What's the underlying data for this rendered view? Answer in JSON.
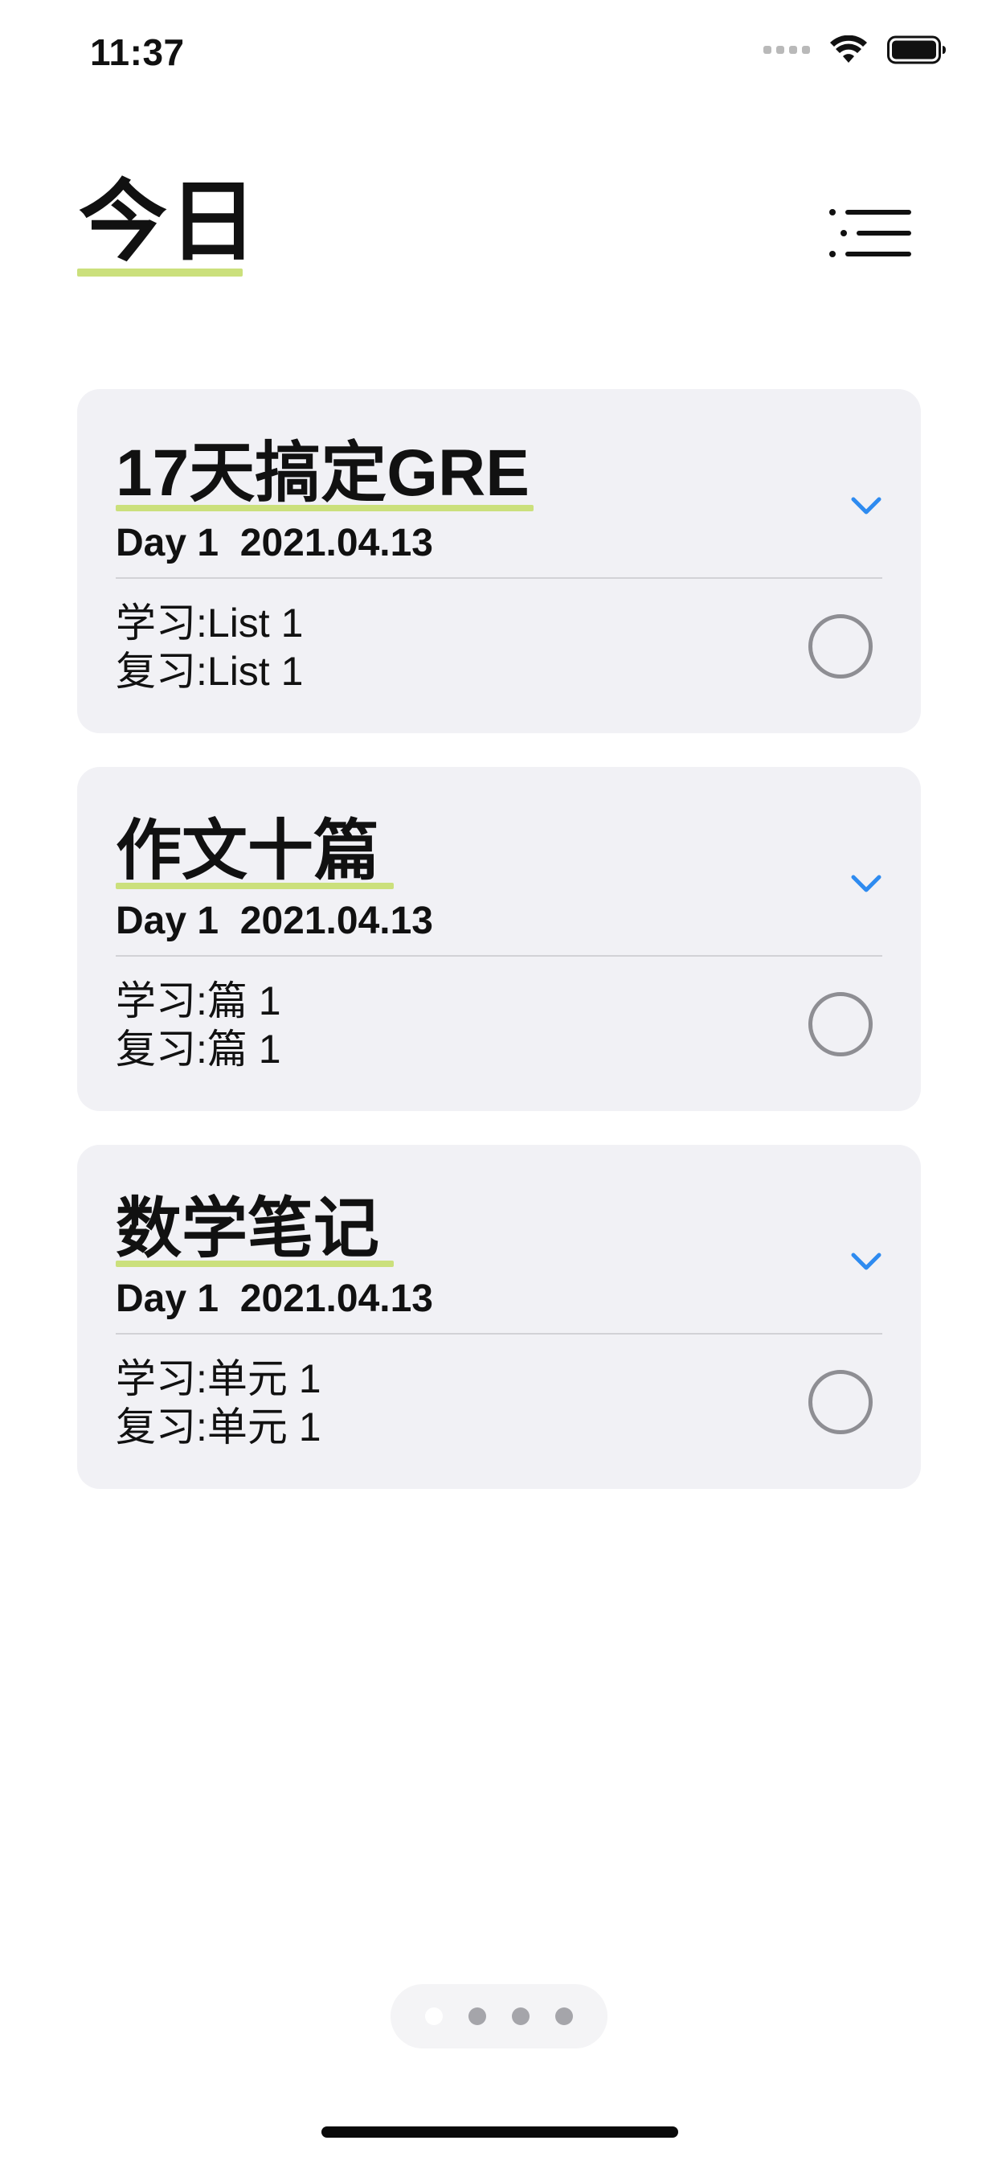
{
  "status_bar": {
    "time": "11:37",
    "icons": [
      "signal-icon",
      "wifi-icon",
      "battery-icon"
    ]
  },
  "header": {
    "title": "今日",
    "menu_icon": "menu-icon"
  },
  "colors": {
    "accent_underline": "#cbe07c",
    "chevron_blue": "#2e8bf0",
    "card_background": "#f1f1f5",
    "circle_gray": "#8e8e93"
  },
  "cards": [
    {
      "title": "17天搞定GRE",
      "subtitle": "Day 1  2021.04.13",
      "study": "学习:List 1",
      "review": "复习:List 1"
    },
    {
      "title": "作文十篇",
      "subtitle": "Day 1  2021.04.13",
      "study": "学习:篇 1",
      "review": "复习:篇 1"
    },
    {
      "title": "数学笔记",
      "subtitle": "Day 1  2021.04.13",
      "study": "学习:单元 1",
      "review": "复习:单元 1"
    }
  ],
  "page_indicator": {
    "count": 4,
    "active_index": 0
  }
}
